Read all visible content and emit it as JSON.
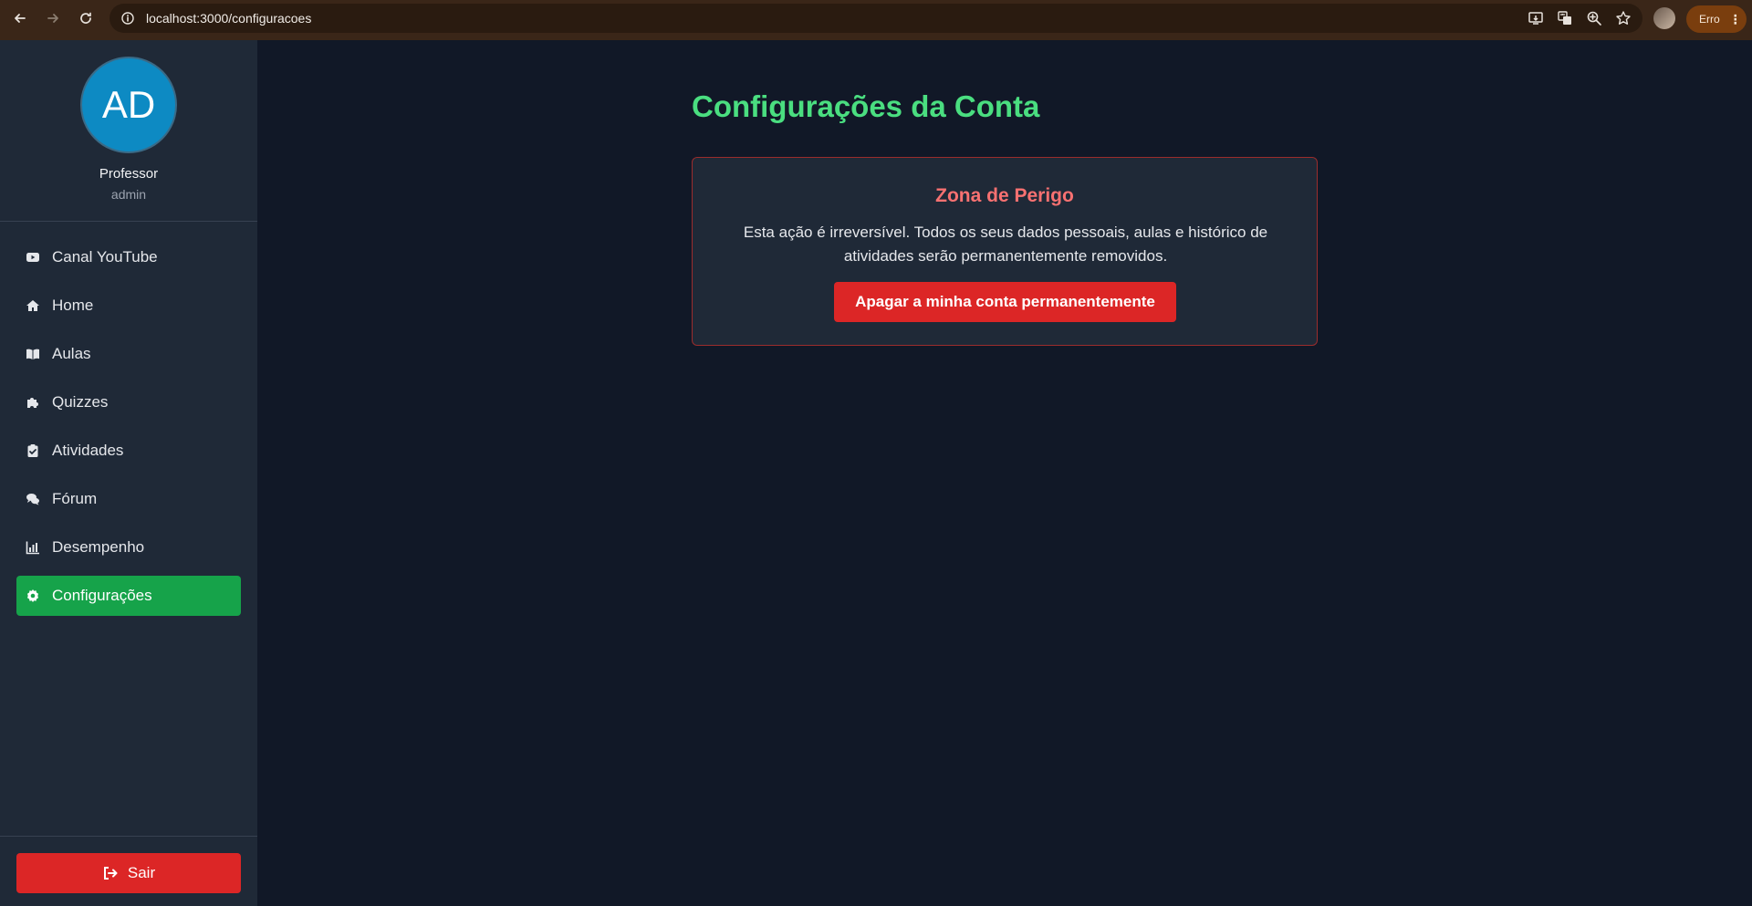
{
  "browser": {
    "url": "localhost:3000/configuracoes",
    "error_chip": "Erro",
    "icons": [
      "back-icon",
      "forward-icon",
      "reload-icon",
      "info-icon",
      "install-icon",
      "translate-icon",
      "zoom-icon",
      "star-icon",
      "menu-dots-icon"
    ]
  },
  "sidebar": {
    "avatar_initials": "AD",
    "user_name": "Professor",
    "user_role": "admin",
    "items": [
      {
        "label": "Canal YouTube",
        "icon": "youtube-icon"
      },
      {
        "label": "Home",
        "icon": "home-icon"
      },
      {
        "label": "Aulas",
        "icon": "book-icon"
      },
      {
        "label": "Quizzes",
        "icon": "puzzle-icon"
      },
      {
        "label": "Atividades",
        "icon": "clipboard-check-icon"
      },
      {
        "label": "Fórum",
        "icon": "comments-icon"
      },
      {
        "label": "Desempenho",
        "icon": "chart-icon"
      },
      {
        "label": "Configurações",
        "icon": "gear-icon",
        "active": true
      }
    ],
    "logout_label": "Sair"
  },
  "main": {
    "title": "Configurações da Conta",
    "danger_zone": {
      "title": "Zona de Perigo",
      "text": "Esta ação é irreversível. Todos os seus dados pessoais, aulas e histórico de atividades serão permanentemente removidos.",
      "button_label": "Apagar a minha conta permanentemente"
    }
  },
  "colors": {
    "accent_green": "#4ade80",
    "active_green": "#16a34a",
    "danger_red": "#dc2626",
    "danger_title": "#f87171",
    "sidebar_bg": "#1f2937",
    "main_bg": "#111827"
  }
}
